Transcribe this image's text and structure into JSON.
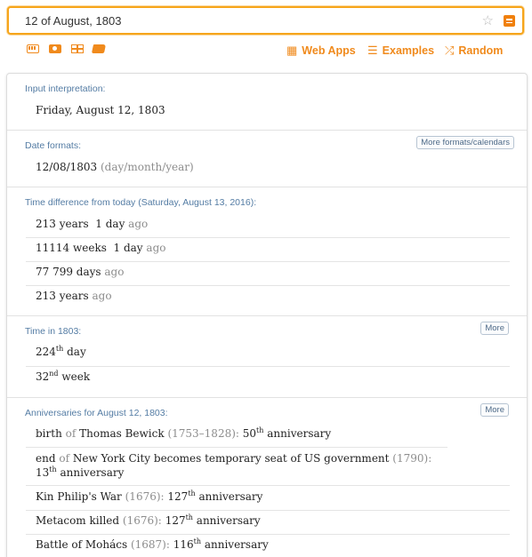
{
  "search": {
    "query": "12 of August, 1803"
  },
  "toolbar": {
    "icons": [
      "keyboard-icon",
      "camera-icon",
      "table-icon",
      "folder-icon"
    ],
    "links": [
      {
        "label": "Web Apps",
        "icon": "grid-icon"
      },
      {
        "label": "Examples",
        "icon": "list-icon"
      },
      {
        "label": "Random",
        "icon": "shuffle-icon"
      }
    ]
  },
  "colors": {
    "accent": "#f08a1c",
    "pod_title": "#547ca4",
    "grey_text": "#8d8d8d"
  },
  "pods": {
    "input": {
      "title": "Input interpretation:",
      "value": "Friday, August 12, 1803"
    },
    "formats": {
      "title": "Date formats:",
      "button": "More formats/calendars",
      "value": "12/08/1803",
      "note": "(day/month/year)"
    },
    "difference": {
      "title": "Time difference from today (Saturday, August 13, 2016):",
      "rows": [
        {
          "text": "213 years  1 day",
          "suffix": "ago"
        },
        {
          "text": "11114 weeks  1 day",
          "suffix": "ago"
        },
        {
          "text": "77 799 days",
          "suffix": "ago"
        },
        {
          "text": "213 years",
          "suffix": "ago"
        }
      ]
    },
    "time_in_year": {
      "title": "Time in 1803:",
      "button": "More",
      "rows": [
        {
          "num": "224",
          "sup": "th",
          "unit": "day"
        },
        {
          "num": "32",
          "sup": "nd",
          "unit": "week"
        }
      ]
    },
    "anniversaries": {
      "title": "Anniversaries for August 12, 1803:",
      "button": "More",
      "rows": [
        {
          "lead": "birth",
          "of": "of",
          "event": "Thomas Bewick",
          "years": "(1753–1828):",
          "count": "50",
          "sup": "th",
          "tail": "anniversary"
        },
        {
          "lead": "end",
          "of": "of",
          "event": "New York City becomes temporary seat of US government",
          "years": "(1790):",
          "count": "13",
          "sup": "th",
          "tail": "anniversary"
        },
        {
          "lead": "",
          "of": "",
          "event": "Kin Philip's War",
          "years": "(1676):",
          "count": "127",
          "sup": "th",
          "tail": "anniversary"
        },
        {
          "lead": "",
          "of": "",
          "event": "Metacom killed",
          "years": "(1676):",
          "count": "127",
          "sup": "th",
          "tail": "anniversary"
        },
        {
          "lead": "",
          "of": "",
          "event": "Battle of Mohács",
          "years": "(1687):",
          "count": "116",
          "sup": "th",
          "tail": "anniversary"
        }
      ]
    }
  }
}
